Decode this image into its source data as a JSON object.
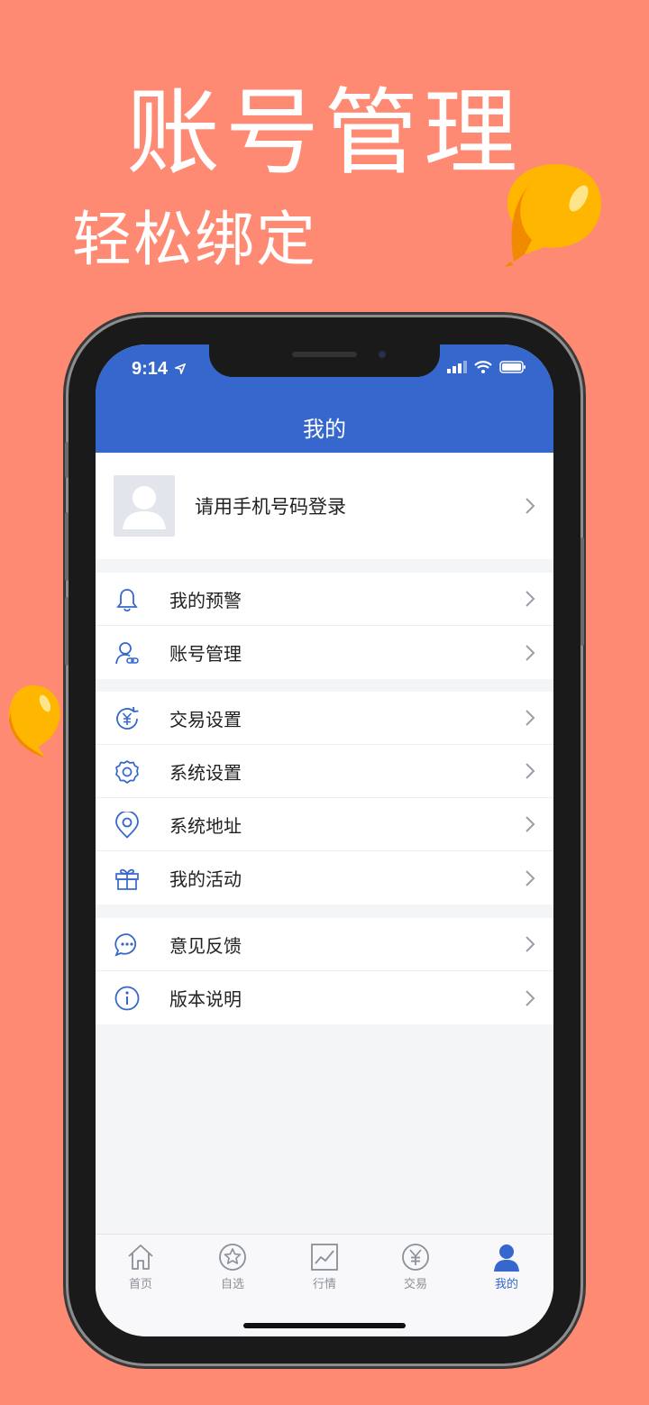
{
  "hero": {
    "title": "账号管理",
    "subtitle": "轻松绑定"
  },
  "colors": {
    "background": "#FF8A73",
    "header": "#3567CC",
    "accent": "#3567CC",
    "balloon": "#FFB600"
  },
  "status_bar": {
    "time": "9:14",
    "icons": [
      "location-arrow-icon",
      "signal-icon",
      "wifi-icon",
      "battery-icon"
    ]
  },
  "header": {
    "title": "我的"
  },
  "profile": {
    "login_prompt": "请用手机号码登录",
    "icon": "avatar-placeholder-icon"
  },
  "menu_groups": [
    {
      "items": [
        {
          "label": "我的预警",
          "icon": "bell-icon"
        },
        {
          "label": "账号管理",
          "icon": "account-link-icon"
        }
      ]
    },
    {
      "items": [
        {
          "label": "交易设置",
          "icon": "yen-refresh-icon"
        },
        {
          "label": "系统设置",
          "icon": "gear-icon"
        },
        {
          "label": "系统地址",
          "icon": "location-pin-icon"
        },
        {
          "label": "我的活动",
          "icon": "gift-icon"
        }
      ]
    },
    {
      "items": [
        {
          "label": "意见反馈",
          "icon": "chat-bubble-icon"
        },
        {
          "label": "版本说明",
          "icon": "info-icon"
        }
      ]
    }
  ],
  "tabbar": {
    "tabs": [
      {
        "label": "首页",
        "icon": "home-icon",
        "active": false
      },
      {
        "label": "自选",
        "icon": "star-icon",
        "active": false
      },
      {
        "label": "行情",
        "icon": "chart-icon",
        "active": false
      },
      {
        "label": "交易",
        "icon": "yen-icon",
        "active": false
      },
      {
        "label": "我的",
        "icon": "user-icon",
        "active": true
      }
    ]
  }
}
